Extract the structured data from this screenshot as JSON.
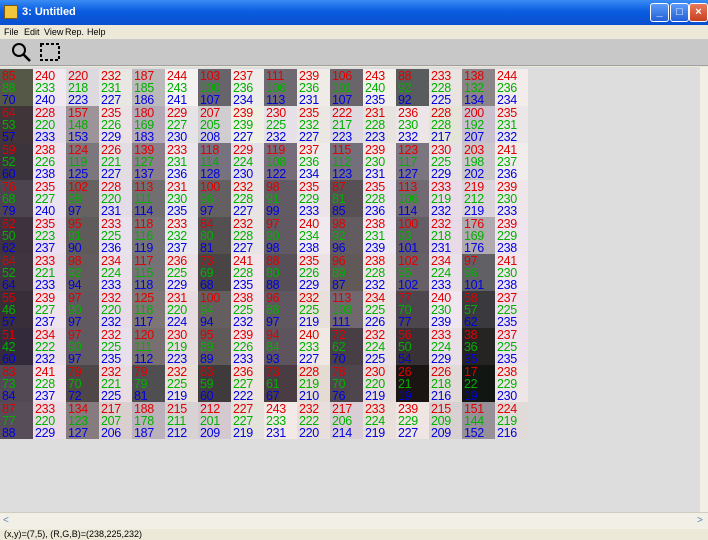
{
  "window": {
    "title": "3: Untitled"
  },
  "menu": [
    "File",
    "Edit",
    "View",
    "Rep.",
    "Help"
  ],
  "tools": [
    {
      "name": "zoom-tool",
      "icon": "magnifier-icon"
    },
    {
      "name": "select-tool",
      "icon": "marquee-select-icon"
    }
  ],
  "colors": {
    "red": "#e00000",
    "green": "#00b000",
    "blue": "#0000e0"
  },
  "grid": {
    "rows": [
      [
        [
          85,
          88,
          70
        ],
        [
          240,
          233,
          240
        ],
        [
          220,
          218,
          223
        ],
        [
          232,
          231,
          227
        ],
        [
          187,
          185,
          186
        ],
        [
          244,
          243,
          241
        ],
        [
          103,
          100,
          107
        ],
        [
          237,
          236,
          234
        ],
        [
          111,
          106,
          113
        ],
        [
          239,
          236,
          231
        ],
        [
          106,
          101,
          107
        ],
        [
          243,
          240,
          235
        ],
        [
          88,
          92,
          92
        ],
        [
          233,
          228,
          225
        ],
        [
          138,
          132,
          134
        ],
        [
          244,
          236,
          234
        ]
      ],
      [
        [
          64,
          53,
          57
        ],
        [
          228,
          220,
          233
        ],
        [
          157,
          148,
          153
        ],
        [
          235,
          226,
          229
        ],
        [
          180,
          169,
          183
        ],
        [
          229,
          227,
          230
        ],
        [
          207,
          205,
          208
        ],
        [
          239,
          239,
          227
        ],
        [
          230,
          225,
          232
        ],
        [
          235,
          232,
          227
        ],
        [
          222,
          217,
          223
        ],
        [
          231,
          228,
          223
        ],
        [
          236,
          230,
          232
        ],
        [
          228,
          228,
          217
        ],
        [
          200,
          192,
          207
        ],
        [
          235,
          231,
          232
        ]
      ],
      [
        [
          59,
          52,
          60
        ],
        [
          238,
          226,
          238
        ],
        [
          124,
          119,
          125
        ],
        [
          226,
          221,
          227
        ],
        [
          139,
          127,
          137
        ],
        [
          233,
          231,
          236
        ],
        [
          118,
          114,
          128
        ],
        [
          229,
          224,
          230
        ],
        [
          119,
          108,
          122
        ],
        [
          237,
          236,
          234
        ],
        [
          115,
          112,
          123
        ],
        [
          239,
          230,
          231
        ],
        [
          123,
          117,
          127
        ],
        [
          230,
          225,
          229
        ],
        [
          203,
          198,
          202
        ],
        [
          241,
          237,
          236
        ]
      ],
      [
        [
          76,
          68,
          79
        ],
        [
          235,
          227,
          240
        ],
        [
          102,
          98,
          97
        ],
        [
          228,
          220,
          231
        ],
        [
          113,
          111,
          114
        ],
        [
          231,
          230,
          235
        ],
        [
          100,
          96,
          97
        ],
        [
          232,
          228,
          227
        ],
        [
          98,
          91,
          99
        ],
        [
          235,
          229,
          233
        ],
        [
          87,
          81,
          85
        ],
        [
          235,
          228,
          236
        ],
        [
          113,
          106,
          114
        ],
        [
          233,
          219,
          232
        ],
        [
          219,
          212,
          219
        ],
        [
          239,
          230,
          233
        ]
      ],
      [
        [
          62,
          50,
          62
        ],
        [
          235,
          223,
          237
        ],
        [
          95,
          91,
          90
        ],
        [
          233,
          225,
          236
        ],
        [
          118,
          116,
          119
        ],
        [
          233,
          232,
          237
        ],
        [
          84,
          80,
          81
        ],
        [
          232,
          228,
          227
        ],
        [
          97,
          90,
          98
        ],
        [
          240,
          234,
          238
        ],
        [
          98,
          92,
          96
        ],
        [
          238,
          231,
          239
        ],
        [
          100,
          93,
          101
        ],
        [
          232,
          218,
          231
        ],
        [
          176,
          169,
          176
        ],
        [
          239,
          229,
          238
        ]
      ],
      [
        [
          64,
          52,
          64
        ],
        [
          233,
          221,
          233
        ],
        [
          98,
          92,
          94
        ],
        [
          234,
          224,
          233
        ],
        [
          117,
          115,
          118
        ],
        [
          236,
          225,
          229
        ],
        [
          73,
          69,
          68
        ],
        [
          241,
          228,
          235
        ],
        [
          88,
          80,
          88
        ],
        [
          235,
          226,
          229
        ],
        [
          96,
          89,
          87
        ],
        [
          238,
          228,
          232
        ],
        [
          102,
          95,
          102
        ],
        [
          234,
          224,
          233
        ],
        [
          97,
          96,
          101
        ],
        [
          241,
          230,
          238
        ]
      ],
      [
        [
          55,
          46,
          57
        ],
        [
          239,
          227,
          237
        ],
        [
          97,
          90,
          97
        ],
        [
          232,
          220,
          232
        ],
        [
          125,
          118,
          117
        ],
        [
          231,
          220,
          224
        ],
        [
          100,
          94,
          94
        ],
        [
          238,
          225,
          232
        ],
        [
          96,
          88,
          97
        ],
        [
          232,
          225,
          219
        ],
        [
          113,
          103,
          111
        ],
        [
          234,
          225,
          226
        ],
        [
          77,
          70,
          77
        ],
        [
          240,
          230,
          239
        ],
        [
          58,
          57,
          62
        ],
        [
          237,
          225,
          235
        ]
      ],
      [
        [
          51,
          42,
          60
        ],
        [
          234,
          222,
          232
        ],
        [
          97,
          90,
          97
        ],
        [
          232,
          225,
          235
        ],
        [
          120,
          111,
          112
        ],
        [
          230,
          219,
          223
        ],
        [
          95,
          89,
          89
        ],
        [
          239,
          226,
          233
        ],
        [
          94,
          84,
          93
        ],
        [
          240,
          233,
          227
        ],
        [
          72,
          62,
          70
        ],
        [
          232,
          224,
          225
        ],
        [
          56,
          50,
          54
        ],
        [
          233,
          224,
          229
        ],
        [
          38,
          36,
          35
        ],
        [
          237,
          225,
          235
        ]
      ],
      [
        [
          83,
          73,
          84
        ],
        [
          241,
          228,
          237
        ],
        [
          79,
          70,
          72
        ],
        [
          232,
          221,
          225
        ],
        [
          79,
          79,
          81
        ],
        [
          232,
          225,
          219
        ],
        [
          63,
          59,
          60
        ],
        [
          236,
          227,
          222
        ],
        [
          73,
          61,
          67
        ],
        [
          228,
          219,
          210
        ],
        [
          78,
          70,
          76
        ],
        [
          230,
          220,
          219
        ],
        [
          26,
          21,
          19
        ],
        [
          226,
          218,
          216
        ],
        [
          17,
          22,
          19
        ],
        [
          238,
          229,
          230
        ]
      ],
      [
        [
          87,
          77,
          88
        ],
        [
          233,
          220,
          229
        ],
        [
          134,
          123,
          127
        ],
        [
          217,
          207,
          206
        ],
        [
          188,
          178,
          187
        ],
        [
          215,
          211,
          212
        ],
        [
          212,
          201,
          209
        ],
        [
          227,
          227,
          219
        ],
        [
          243,
          233,
          231
        ],
        [
          232,
          222,
          220
        ],
        [
          217,
          206,
          214
        ],
        [
          233,
          224,
          219
        ],
        [
          239,
          229,
          227
        ],
        [
          215,
          209,
          209
        ],
        [
          151,
          144,
          152
        ],
        [
          224,
          219,
          216
        ]
      ]
    ]
  },
  "status": {
    "readout": "(x,y)=(7,5), (R,G,B)=(238,225,232)"
  }
}
